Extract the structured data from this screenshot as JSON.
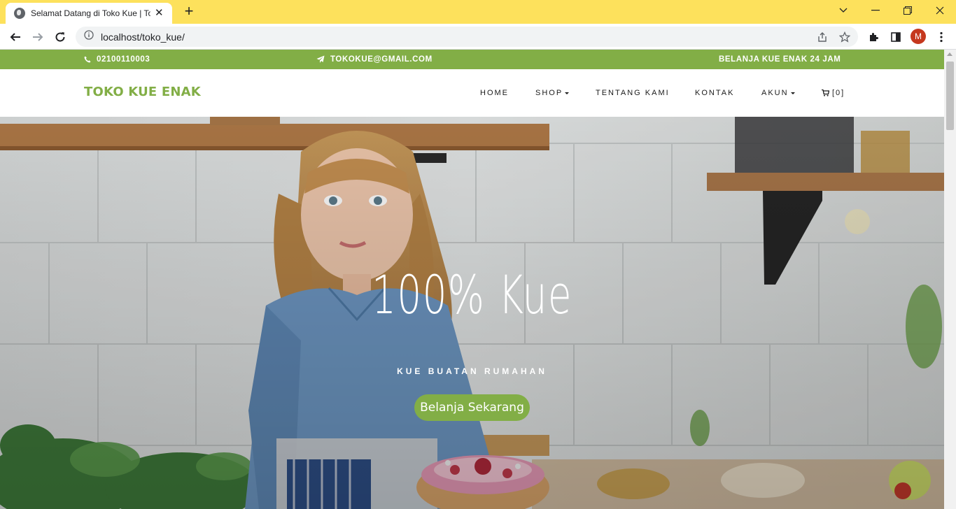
{
  "browser": {
    "tab_title": "Selamat Datang di Toko Kue | Toko Kue",
    "url": "localhost/toko_kue/",
    "profile_initial": "M",
    "tabbar_color": "#fde15c"
  },
  "topbar": {
    "phone": "02100110003",
    "email": "TOKOKUE@GMAIL.COM",
    "tagline": "BELANJA KUE ENAK 24 JAM",
    "bg_color": "#82ae46"
  },
  "navbar": {
    "brand": "TOKO KUE ENAK",
    "items": [
      {
        "label": "HOME",
        "dropdown": false
      },
      {
        "label": "SHOP",
        "dropdown": true
      },
      {
        "label": "TENTANG KAMI",
        "dropdown": false
      },
      {
        "label": "KONTAK",
        "dropdown": false
      },
      {
        "label": "AKUN",
        "dropdown": true
      }
    ],
    "cart_count": "[0]"
  },
  "hero": {
    "title": "100% Kue",
    "subtitle": "KUE BUATAN RUMAHAN",
    "button": "Belanja Sekarang"
  },
  "icons": [
    "globe-icon",
    "close-icon",
    "plus-icon",
    "chevron-down-icon",
    "minimize-icon",
    "restore-icon",
    "back-arrow-icon",
    "forward-arrow-icon",
    "reload-icon",
    "info-icon",
    "share-icon",
    "star-icon",
    "extension-icon",
    "sidebar-icon",
    "more-icon",
    "phone-icon",
    "paper-plane-icon",
    "cart-icon"
  ]
}
